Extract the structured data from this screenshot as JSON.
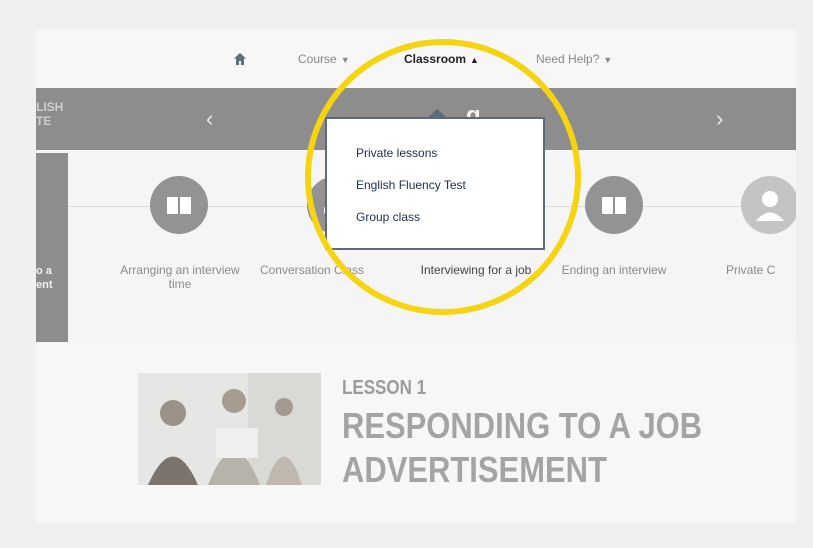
{
  "nav": {
    "course": "Course",
    "classroom": "Classroom",
    "help": "Need Help?",
    "icons": {
      "home": "home-icon",
      "caret_down": "caret-down-icon",
      "caret_up": "caret-up-icon"
    }
  },
  "banner": {
    "left_text_line1": "LISH",
    "left_text_line2": "TE",
    "title_fragment": "g",
    "prev_icon": "chevron-left-icon",
    "next_icon": "chevron-right-icon"
  },
  "strip": {
    "left_card_line1": "o a",
    "left_card_line2": "ent",
    "lessons": [
      {
        "label": "Arranging an interview time",
        "icon": "book-icon"
      },
      {
        "label": "Conversation Class",
        "icon": "group-icon"
      },
      {
        "label": "Interviewing for a job",
        "icon": ""
      },
      {
        "label": "Ending an interview",
        "icon": "book-icon"
      },
      {
        "label": "Private C",
        "icon": "user-icon"
      }
    ]
  },
  "dropdown": {
    "items": [
      "Private lessons",
      "English Fluency Test",
      "Group class"
    ]
  },
  "lesson": {
    "kicker": "LESSON 1",
    "title_line1": "RESPONDING TO A JOB",
    "title_line2": "ADVERTISEMENT"
  },
  "colors": {
    "banner_bg": "#8d8d8d",
    "highlight": "#f7d411",
    "dropdown_border": "#5d6a7a",
    "dropdown_text": "#1d2f4a"
  }
}
